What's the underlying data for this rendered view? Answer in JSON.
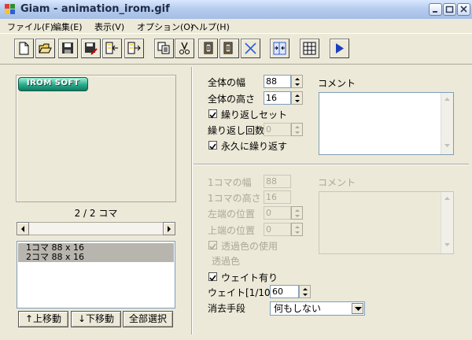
{
  "window": {
    "title": "Giam - animation_irom.gif"
  },
  "menu": [
    "ファイル(F)",
    "編集(E)",
    "表示(V)",
    "オプション(O)",
    "ヘルプ(H)"
  ],
  "toolbar": {
    "icons": [
      "new-file-icon",
      "open-folder-icon",
      "save-icon",
      "save-as-icon",
      "import-before-icon",
      "import-after-icon",
      "copy-icon",
      "cut-icon",
      "paste-before-icon",
      "paste-after-icon",
      "delete-icon",
      "fit-icon",
      "grid-icon",
      "play-icon"
    ]
  },
  "preview": {
    "logo_text": "IROM SOFT",
    "frame_counter": "2 / 2 コマ"
  },
  "frames": {
    "rows": [
      "1コマ 88 x 16",
      "2コマ 88 x 16"
    ],
    "buttons": {
      "up": "↑上移動",
      "down": "↓下移動",
      "select_all": "全部選択"
    }
  },
  "global": {
    "width_label": "全体の幅",
    "width": "88",
    "height_label": "全体の高さ",
    "height": "16",
    "loop_set_label": "繰り返しセット",
    "loop_count_label": "繰り返し回数",
    "loop_count": "0",
    "forever_label": "永久に繰り返す",
    "comment_label": "コメント"
  },
  "frame": {
    "width_label": "1コマの幅",
    "width": "88",
    "height_label": "1コマの高さ",
    "height": "16",
    "left_label": "左端の位置",
    "left": "0",
    "top_label": "上端の位置",
    "top": "0",
    "transparent_use_label": "透過色の使用",
    "transparent_color_label": "透過色",
    "wait_enabled_label": "ウェイト有り",
    "wait_label": "ウェイト[1/100s]",
    "wait": "60",
    "dispose_label": "消去手段",
    "dispose": "何もしない",
    "comment_label": "コメント"
  }
}
